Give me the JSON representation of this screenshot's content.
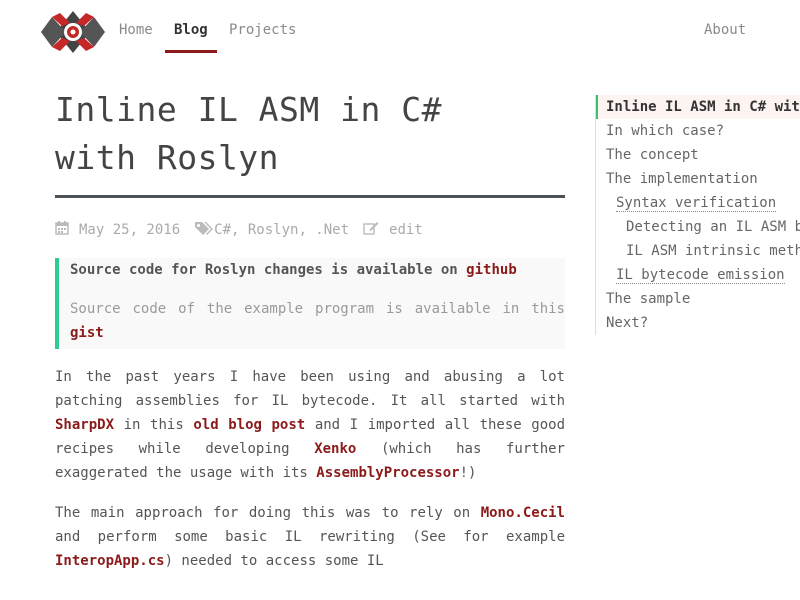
{
  "nav": {
    "home": "Home",
    "blog": "Blog",
    "projects": "Projects",
    "about": "About"
  },
  "article": {
    "title_line1": "Inline IL ASM in C#",
    "title_line2": "with Roslyn",
    "date": "May 25, 2016",
    "tags": "C#, Roslyn, .Net",
    "edit": "edit",
    "callout1_text": "Source code for Roslyn changes is available on",
    "callout1_link": "github",
    "callout2_text": "Source code of the example program is available in this",
    "callout2_link": "gist",
    "p1": {
      "t1": "In the past years I have been using and abusing a lot patching assemblies for IL bytecode. It all started with ",
      "l1": "SharpDX",
      "t2": " in this ",
      "l2": "old blog post",
      "t3": " and I imported all these good recipes while developing ",
      "l3": "Xenko",
      "t4": " (which has further exaggerated the usage with its ",
      "l4": "AssemblyProcessor",
      "t5": "!)"
    },
    "p2": {
      "t1": "The main approach for doing this was to rely on ",
      "l1": "Mono.Cecil",
      "t2": " and perform some basic IL rewriting (See for example ",
      "l2": "InteropApp.cs",
      "t3": ") needed to access some IL"
    }
  },
  "toc": [
    "Inline IL ASM in C# with Roslyn",
    "In which case?",
    "The concept",
    "The implementation",
    "Syntax verification",
    "Detecting an IL ASM block",
    "IL ASM intrinsic method",
    "IL bytecode emission",
    "The sample",
    "Next?"
  ],
  "colors": {
    "accent": "#8b1a1a",
    "callout_border": "#2ecc8f",
    "title_rule": "#4a5257"
  }
}
